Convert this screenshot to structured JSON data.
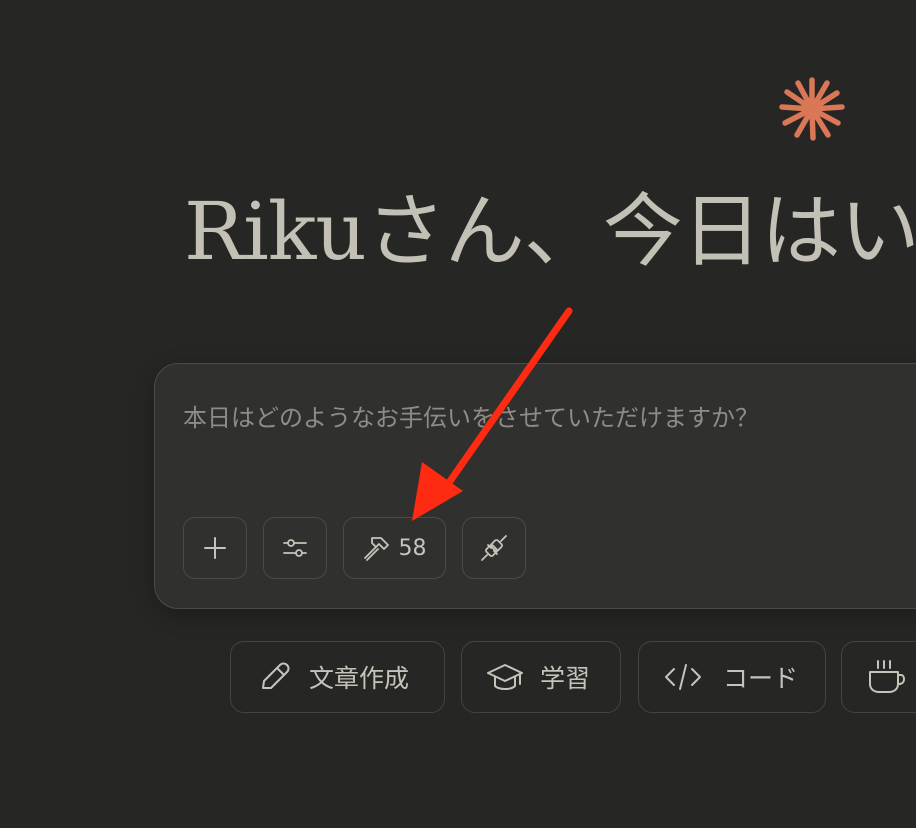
{
  "greeting": "Rikuさん、今日はい",
  "composer": {
    "placeholder": "本日はどのようなお手伝いをさせていただけますか？"
  },
  "toolbar": {
    "tools_count": "58"
  },
  "chips": {
    "write": "文章作成",
    "learn": "学習",
    "code": "コード"
  },
  "icons": {
    "logo": "spark-logo-icon",
    "add": "plus-icon",
    "settings": "sliders-icon",
    "tools": "hammer-icon",
    "connect": "plug-icon",
    "write": "pencil-icon",
    "learn": "graduation-cap-icon",
    "code": "code-brackets-icon",
    "life": "coffee-cup-icon"
  },
  "colors": {
    "background": "#262624",
    "accent": "#d97757",
    "annotation_arrow": "#ff2a12"
  }
}
